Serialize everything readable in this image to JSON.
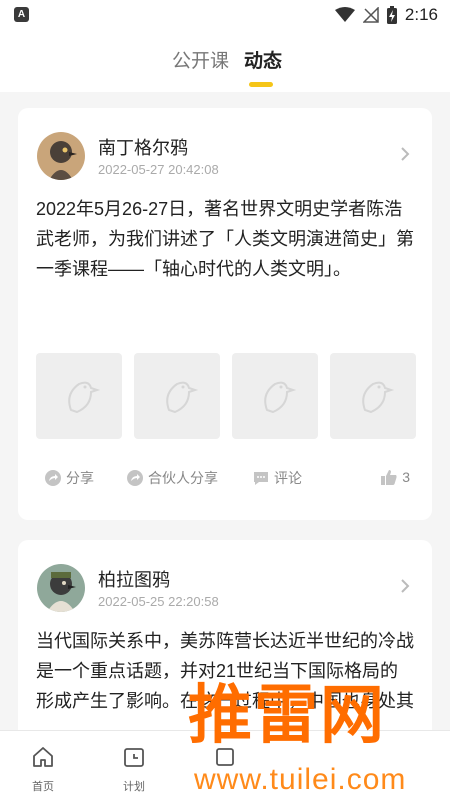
{
  "status_bar": {
    "time": "2:16"
  },
  "tabs": [
    {
      "label": "公开课",
      "active": false
    },
    {
      "label": "动态",
      "active": true
    }
  ],
  "accent_color": "#f5c518",
  "posts": [
    {
      "author": "南丁格尔鸦",
      "timestamp": "2022-05-27 20:42:08",
      "text": "2022年5月26-27日，著名世界文明史学者陈浩武老师，为我们讲述了「人类文明演进简史」第一季课程——「轴心时代的人类文明」。",
      "actions": {
        "share": "分享",
        "partner_share": "合伙人分享",
        "comment": "评论",
        "likes": "3"
      }
    },
    {
      "author": "柏拉图鸦",
      "timestamp": "2022-05-25 22:20:58",
      "text": "当代国际关系中，美苏阵营长达近半世纪的冷战是一个重点话题，并对21世纪当下国际格局的形成产生了影响。在这一过程中，中国也身处其"
    }
  ],
  "bottom_nav": [
    {
      "label": "首页",
      "icon": "home-icon"
    },
    {
      "label": "计划",
      "icon": "calendar-icon"
    }
  ],
  "watermark": {
    "brand": "推雷网",
    "url": "www.tuilei.com"
  }
}
